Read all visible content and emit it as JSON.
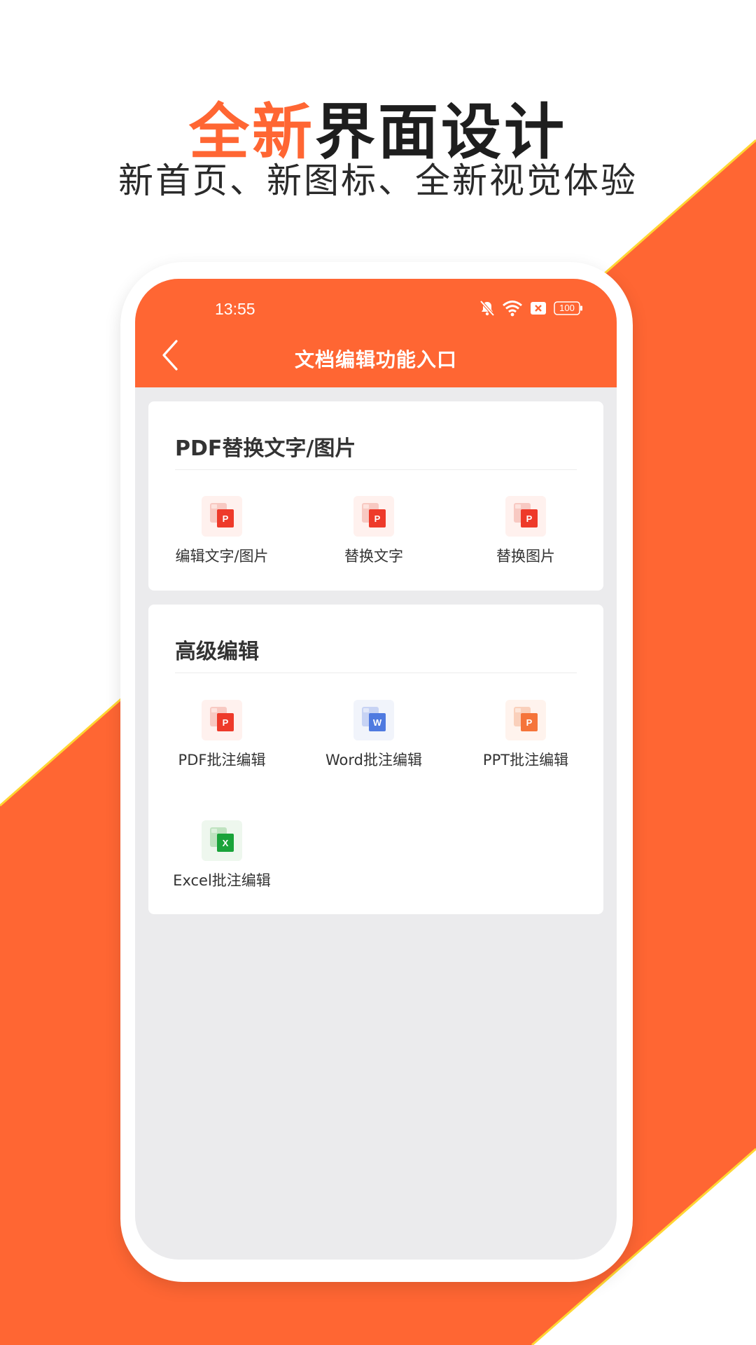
{
  "promo": {
    "headline_accent": "全新",
    "headline_rest": "界面设计",
    "subline": "新首页、新图标、全新视觉体验",
    "accent_color": "#ff6633"
  },
  "status_bar": {
    "time": "13:55",
    "battery": "100",
    "icons": [
      "bell-off-icon",
      "wifi-icon",
      "sim-error-icon",
      "battery-icon"
    ]
  },
  "app_bar": {
    "title": "文档编辑功能入口",
    "back_icon": "chevron-left-icon"
  },
  "sections": [
    {
      "title": "PDF替换文字/图片",
      "items": [
        {
          "label": "编辑文字/图片",
          "icon": "pdf-file-icon"
        },
        {
          "label": "替换文字",
          "icon": "pdf-file-icon"
        },
        {
          "label": "替换图片",
          "icon": "pdf-file-icon"
        }
      ]
    },
    {
      "title": "高级编辑",
      "items": [
        {
          "label": "PDF批注编辑",
          "icon": "pdf-file-icon"
        },
        {
          "label": "Word批注编辑",
          "icon": "word-file-icon"
        },
        {
          "label": "PPT批注编辑",
          "icon": "ppt-file-icon"
        },
        {
          "label": "Excel批注编辑",
          "icon": "excel-file-icon"
        }
      ]
    }
  ]
}
